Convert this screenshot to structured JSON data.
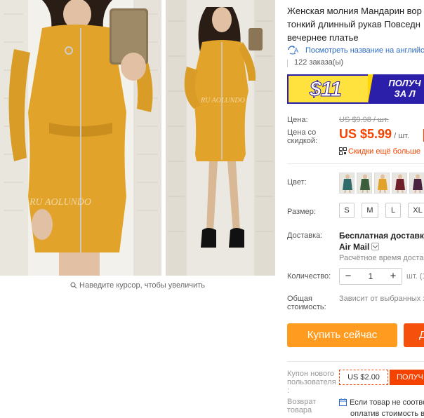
{
  "gallery": {
    "watermark": "RU AOLUNDO",
    "watermark_small": "RU AOLUNDO",
    "zoom_hint": "Наведите курсор, чтобы увеличить",
    "dress_color": "#e2a32a"
  },
  "product": {
    "title_lines": [
      "Женская молния Мандарин вор",
      "тонкий длинный рукав Повседн",
      "вечернее платье"
    ],
    "translate_link": "Посмотреть название на английс",
    "orders": "122 заказа(ы)"
  },
  "banner": {
    "amount": "$11",
    "line1": "ПОЛУЧ",
    "line2": "ЗА Л"
  },
  "pricing": {
    "price_label": "Цена:",
    "old_price": "US $9.98 / шт.",
    "discount_label_1": "Цена со",
    "discount_label_2": "скидкой:",
    "price": "US $5.99",
    "price_unit": " / шт.",
    "promo": "Скидки ещё больше",
    "accent_color": "#f44300"
  },
  "options": {
    "color_label": "Цвет:",
    "size_label": "Размер:",
    "sizes": [
      "S",
      "M",
      "L",
      "XL"
    ]
  },
  "shipping": {
    "label": "Доставка:",
    "main": "Бесплатная доставка в",
    "method": "Air Mail",
    "time": "Расчётное время доставки"
  },
  "quantity": {
    "label": "Количество:",
    "value": "1",
    "minus": "−",
    "plus": "+",
    "unit": "шт. (1"
  },
  "total": {
    "label_1": "Общая",
    "label_2": "стоимость:",
    "value": "Зависит от выбранных х"
  },
  "actions": {
    "buy_now": "Купить сейчас",
    "add_to_cart": "Д"
  },
  "coupon": {
    "label_1": "Купон нового",
    "label_2": "пользователя",
    "label_3": ":",
    "value": "US $2.00",
    "button": "ПОЛУЧ"
  },
  "returns": {
    "label_1": "Возврат",
    "label_2": "товара",
    "line_1": "Если товар не соотве",
    "line_2": "оплатив стоимость в"
  }
}
